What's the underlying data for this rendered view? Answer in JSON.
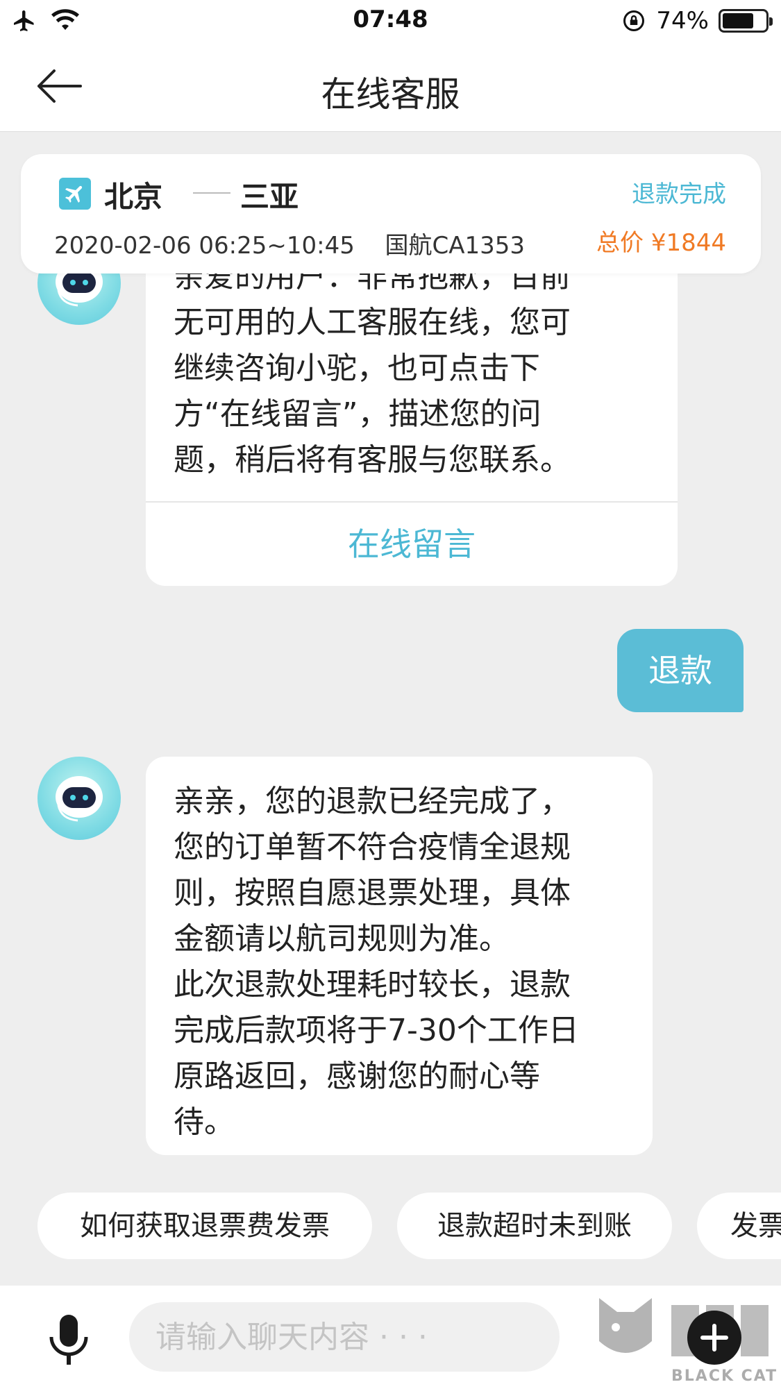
{
  "status_bar": {
    "time": "07:48",
    "battery": "74%",
    "battery_level": 0.74
  },
  "nav": {
    "title": "在线客服"
  },
  "order": {
    "from": "北京",
    "to": "三亚",
    "datetime": "2020-02-06 06:25~10:45",
    "flight": "国航CA1353",
    "status": "退款完成",
    "price": "总价 ¥1844"
  },
  "messages": {
    "bot_1": {
      "text": "亲爱的用户：非常抱歉，目前\n无可用的人工客服在线，您可\n继续咨询小驼，也可点击下\n方“在线留言”，描述您的问\n题，稍后将有客服与您联系。",
      "action": "在线留言"
    },
    "user_1": {
      "text": "退款"
    },
    "bot_2": {
      "text": "亲亲，您的退款已经完成了，\n您的订单暂不符合疫情全退规\n则，按照自愿退票处理，具体\n金额请以航司规则为准。\n此次退款处理耗时较长，退款\n完成后款项将于7-30个工作日\n原路返回，感谢您的耐心等\n待。"
    }
  },
  "quick_replies": [
    "如何获取退票费发票",
    "退款超时未到账",
    "发票"
  ],
  "input": {
    "placeholder": "请输入聊天内容 · · ·"
  },
  "watermark": {
    "text": "BLACK CAT"
  },
  "colors": {
    "accent": "#4cb8d4",
    "price": "#f07a24",
    "user_bubble": "#5bbdd6"
  },
  "icons": [
    "airplane-icon",
    "wifi-icon",
    "rotation-lock-icon",
    "battery-icon",
    "back-arrow-icon",
    "flight-icon",
    "bot-avatar-icon",
    "microphone-icon",
    "plus-icon"
  ]
}
